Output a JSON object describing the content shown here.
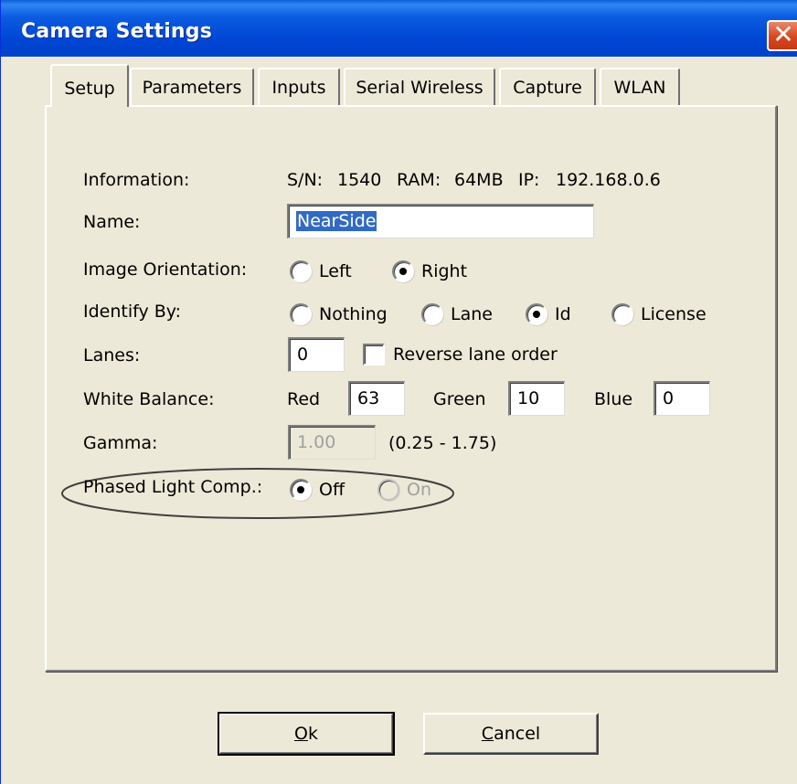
{
  "window": {
    "title": "Camera Settings",
    "close_glyph": "✕"
  },
  "tabs": [
    {
      "label": "Setup",
      "active": true
    },
    {
      "label": "Parameters",
      "active": false
    },
    {
      "label": "Inputs",
      "active": false
    },
    {
      "label": "Serial Wireless",
      "active": false
    },
    {
      "label": "Capture",
      "active": false
    },
    {
      "label": "WLAN",
      "active": false
    }
  ],
  "setup": {
    "information": {
      "label": "Information:",
      "sn_label": "S/N:",
      "sn_value": "1540",
      "ram_label": "RAM:",
      "ram_value": "64MB",
      "ip_label": "IP:",
      "ip_value": "192.168.0.6"
    },
    "name": {
      "label": "Name:",
      "value": "NearSide"
    },
    "image_orientation": {
      "label": "Image Orientation:",
      "options": [
        "Left",
        "Right"
      ],
      "selected": "Right"
    },
    "identify_by": {
      "label": "Identify By:",
      "options": [
        "Nothing",
        "Lane",
        "Id",
        "License"
      ],
      "selected": "Id"
    },
    "lanes": {
      "label": "Lanes:",
      "value": "0",
      "reverse_label": "Reverse lane order",
      "reverse_checked": false
    },
    "white_balance": {
      "label": "White Balance:",
      "red_label": "Red",
      "red_value": "63",
      "green_label": "Green",
      "green_value": "10",
      "blue_label": "Blue",
      "blue_value": "0"
    },
    "gamma": {
      "label": "Gamma:",
      "value": "1.00",
      "range": "(0.25 - 1.75)"
    },
    "phased_light": {
      "label": "Phased Light Comp.:",
      "off_label": "Off",
      "on_label": "On",
      "selected": "Off"
    }
  },
  "buttons": {
    "ok": "Ok",
    "cancel": "Cancel"
  },
  "colors": {
    "titlebar": "#0046d6",
    "dialog_bg": "#ece9d8",
    "selection": "#316ac5",
    "close": "#d8461e"
  }
}
